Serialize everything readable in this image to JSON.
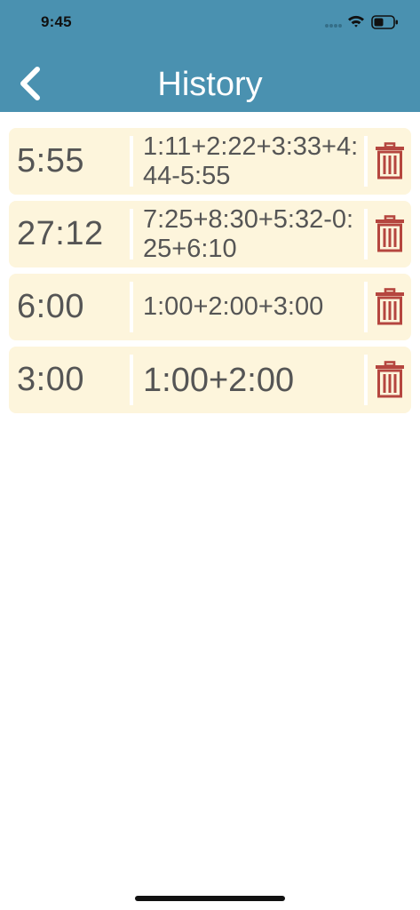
{
  "status_bar": {
    "time": "9:45"
  },
  "nav": {
    "title": "History",
    "back_icon": "chevron-left-icon"
  },
  "history": [
    {
      "total": "5:55",
      "expression": "1:11+2:22+3:33+4:44-5:55"
    },
    {
      "total": "27:12",
      "expression": "7:25+8:30+5:32-0:25+6:10"
    },
    {
      "total": "6:00",
      "expression": "1:00+2:00+3:00"
    },
    {
      "total": "3:00",
      "expression": "1:00+2:00"
    }
  ],
  "colors": {
    "header": "#4a91b0",
    "row_background": "#fdf5dc",
    "text": "#555555",
    "delete": "#b5463f"
  }
}
